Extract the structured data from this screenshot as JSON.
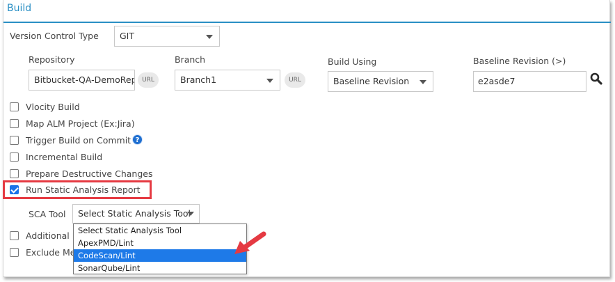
{
  "section_title": "Build",
  "version_control": {
    "label": "Version Control Type",
    "value": "GIT"
  },
  "repository": {
    "label": "Repository",
    "value": "Bitbucket-QA-DemoRep",
    "url_badge": "URL"
  },
  "branch": {
    "label": "Branch",
    "value": "Branch1",
    "url_badge": "URL"
  },
  "build_using": {
    "label": "Build Using",
    "value": "Baseline Revision"
  },
  "baseline_revision": {
    "label": "Baseline Revision (>)",
    "value": "e2asde7"
  },
  "checkboxes": [
    {
      "label": "Vlocity Build",
      "checked": false
    },
    {
      "label": "Map ALM Project (Ex:Jira)",
      "checked": false
    },
    {
      "label": "Trigger Build on Commit",
      "checked": false
    },
    {
      "label": "Incremental Build",
      "checked": false
    },
    {
      "label": "Prepare Destructive Changes",
      "checked": false
    },
    {
      "label": "Run Static Analysis Report",
      "checked": true
    },
    {
      "label": "Additional F",
      "checked": false
    },
    {
      "label": "Exclude Me",
      "checked": false
    }
  ],
  "help_icon_text": "?",
  "sca_tool": {
    "label": "SCA Tool",
    "value": "Select Static Analysis Tool",
    "options": [
      "Select Static Analysis Tool",
      "ApexPMD/Lint",
      "CodeScan/Lint",
      "SonarQube/Lint"
    ],
    "highlighted_option": "CodeScan/Lint"
  },
  "colors": {
    "accent": "#2a8fc4",
    "highlight_border": "#e53a42",
    "selection": "#1e7ae8",
    "checkbox": "#1a73e8"
  }
}
